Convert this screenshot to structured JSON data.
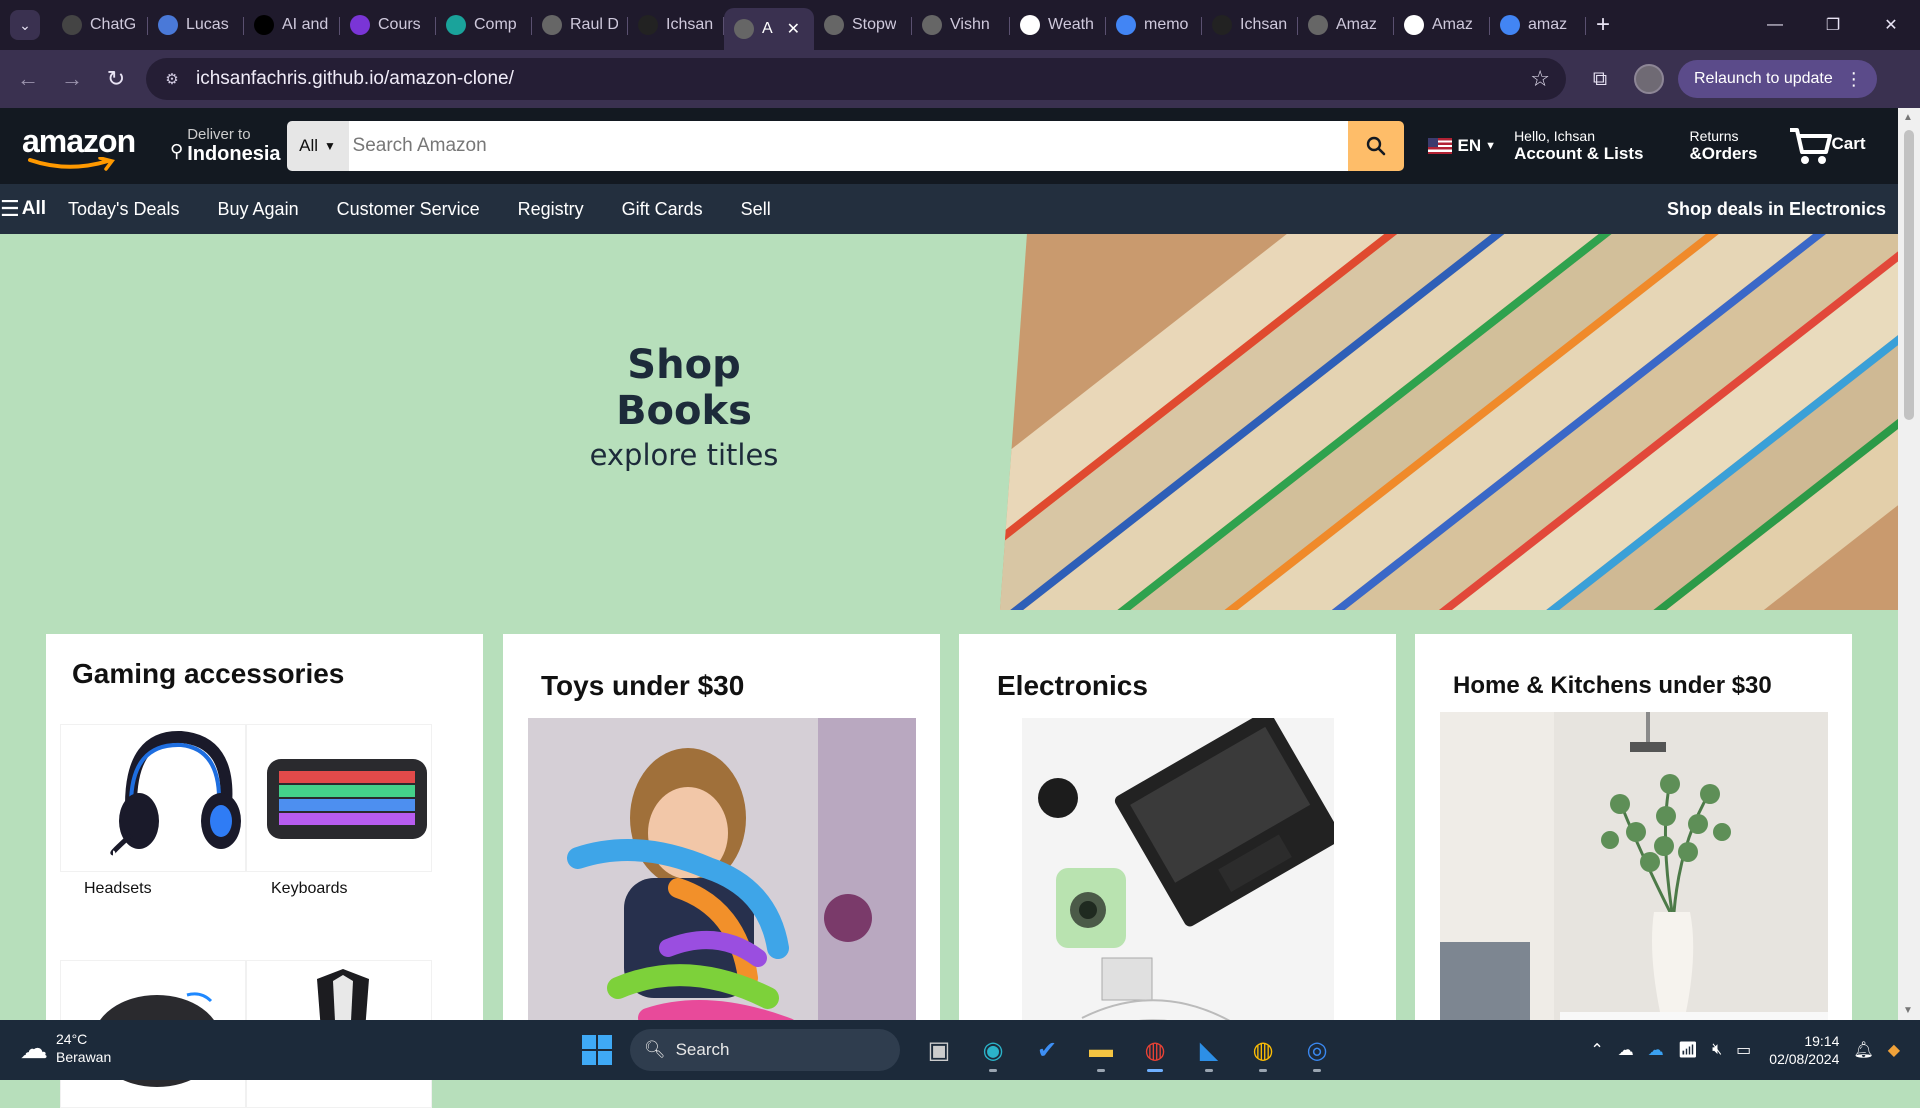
{
  "browser": {
    "tabs": [
      {
        "title": "ChatG",
        "fav": "chatgpt-icon",
        "color": "#444"
      },
      {
        "title": "Lucas",
        "fav": "lucas-icon",
        "color": "#4a79d8"
      },
      {
        "title": "AI and",
        "fav": "ai-icon",
        "color": "#000"
      },
      {
        "title": "Cours",
        "fav": "course-icon",
        "color": "#7a35d6"
      },
      {
        "title": "Comp",
        "fav": "v-icon",
        "color": "#1aa39b"
      },
      {
        "title": "Raul D",
        "fav": "globe-icon",
        "color": "#666"
      },
      {
        "title": "Ichsan",
        "fav": "github-icon",
        "color": "#222"
      },
      {
        "title": "A",
        "fav": "globe-icon",
        "color": "#666",
        "active": true
      },
      {
        "title": "Stopw",
        "fav": "globe-icon",
        "color": "#666"
      },
      {
        "title": "Vishn",
        "fav": "globe-icon",
        "color": "#666"
      },
      {
        "title": "Weath",
        "fav": "w-icon",
        "color": "#fff"
      },
      {
        "title": "memo",
        "fav": "google-icon",
        "color": "#4285f4"
      },
      {
        "title": "Ichsan",
        "fav": "github-icon",
        "color": "#222"
      },
      {
        "title": "Amaz",
        "fav": "globe-icon",
        "color": "#666"
      },
      {
        "title": "Amaz",
        "fav": "amazon-icon",
        "color": "#fff"
      },
      {
        "title": "amaz",
        "fav": "google-icon",
        "color": "#4285f4"
      }
    ],
    "url": "ichsanfachris.github.io/amazon-clone/",
    "relaunch_label": "Relaunch to update"
  },
  "amazon": {
    "logo_text": "amazon",
    "deliver_line1": "Deliver to",
    "deliver_line2": "Indonesia",
    "search_category": "All",
    "search_placeholder": "Search Amazon",
    "lang": "EN",
    "account_line1": "Hello, Ichsan",
    "account_line2": "Account & Lists",
    "returns_line1": "Returns",
    "returns_line2": "&Orders",
    "cart_label": "Cart",
    "subnav_all": "All",
    "subnav_items": [
      "Today's Deals",
      "Buy Again",
      "Customer Service",
      "Registry",
      "Gift Cards",
      "Sell"
    ],
    "subnav_promo": "Shop deals in Electronics",
    "hero_title": "Shop Books",
    "hero_subtitle": "explore titles",
    "cards": {
      "gaming_title": "Gaming accessories",
      "gaming_items": [
        "Headsets",
        "Keyboards"
      ],
      "toys_title": "Toys under $30",
      "electronics_title": "Electronics",
      "home_title": "Home & Kitchens under $30"
    }
  },
  "taskbar": {
    "temp": "24°C",
    "condition": "Berawan",
    "search_label": "Search",
    "time": "19:14",
    "date": "02/08/2024"
  },
  "colors": {
    "amazon_dark": "#131921",
    "amazon_sub": "#232f3e",
    "search_button": "#febd69",
    "hero_bg": "#b7dfbb"
  }
}
